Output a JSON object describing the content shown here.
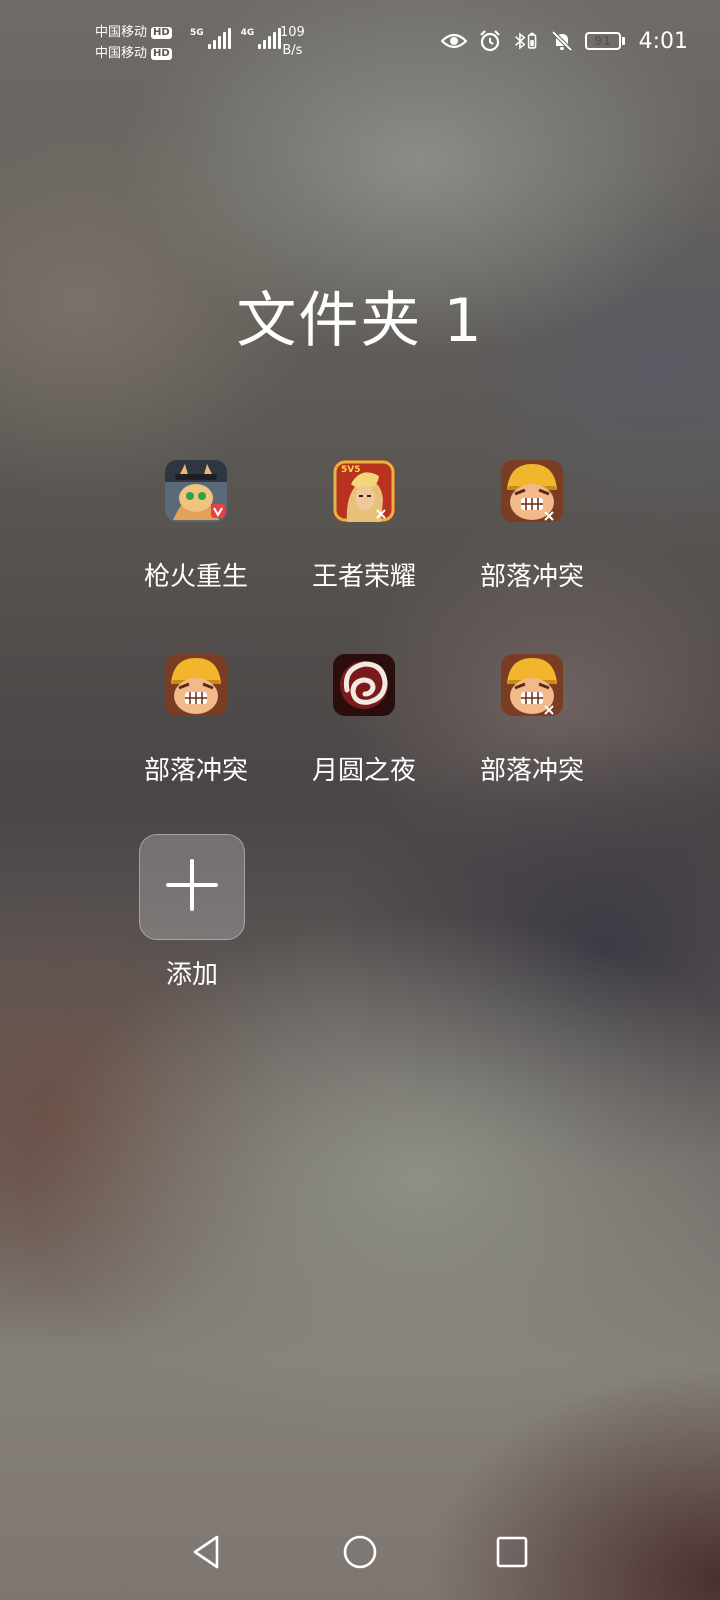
{
  "status_bar": {
    "carrier_1": "中国移动",
    "carrier_2": "中国移动",
    "hd_badge": "HD",
    "signal_1_tag": "5G",
    "signal_2_tag": "4G",
    "net_speed_value": "109",
    "net_speed_unit": "B/s",
    "battery_level": "91",
    "time": "4:01"
  },
  "folder": {
    "title": "文件夹 1"
  },
  "apps": [
    {
      "label": "枪火重生",
      "icon": "gunfire-reborn-icon"
    },
    {
      "label": "王者荣耀",
      "icon": "honor-of-kings-icon"
    },
    {
      "label": "部落冲突",
      "icon": "clash-of-clans-icon"
    },
    {
      "label": "部落冲突",
      "icon": "clash-of-clans-icon"
    },
    {
      "label": "月圆之夜",
      "icon": "full-moon-night-icon"
    },
    {
      "label": "部落冲突",
      "icon": "clash-of-clans-icon"
    }
  ],
  "add_button": {
    "label": "添加"
  },
  "colors": {
    "text": "#ffffff",
    "wallpaper_base": "#5f5a56"
  }
}
